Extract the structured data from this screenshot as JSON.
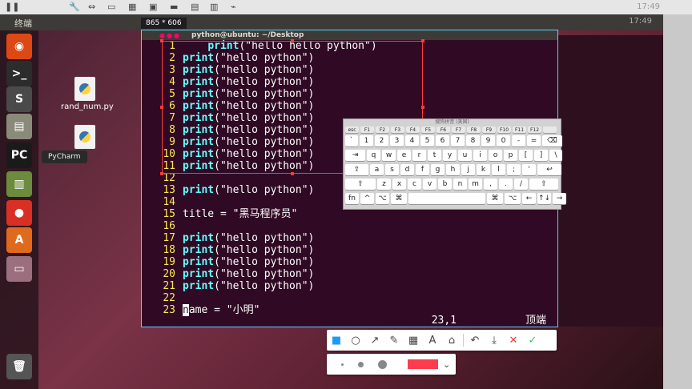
{
  "host": {
    "clock": "17:49"
  },
  "unity": {
    "title": "终端"
  },
  "size_label": "865 * 606",
  "terminal": {
    "title": "python@ubuntu: ~/Desktop",
    "lines": [
      {
        "n": "1",
        "pre": "    ",
        "kw": "print",
        "rest": "(\"hello hello python\")"
      },
      {
        "n": "2",
        "pre": "",
        "kw": "print",
        "rest": "(\"hello python\")"
      },
      {
        "n": "3",
        "pre": "",
        "kw": "print",
        "rest": "(\"hello python\")"
      },
      {
        "n": "4",
        "pre": "",
        "kw": "print",
        "rest": "(\"hello python\")"
      },
      {
        "n": "5",
        "pre": "",
        "kw": "print",
        "rest": "(\"hello python\")"
      },
      {
        "n": "6",
        "pre": "",
        "kw": "print",
        "rest": "(\"hello python\")"
      },
      {
        "n": "7",
        "pre": "",
        "kw": "print",
        "rest": "(\"hello python\")"
      },
      {
        "n": "8",
        "pre": "",
        "kw": "print",
        "rest": "(\"hello python\")"
      },
      {
        "n": "9",
        "pre": "",
        "kw": "print",
        "rest": "(\"hello python\")"
      },
      {
        "n": "10",
        "pre": "",
        "kw": "print",
        "rest": "(\"hello python\")"
      },
      {
        "n": "11",
        "pre": "",
        "kw": "print",
        "rest": "(\"hello python\")"
      },
      {
        "n": "12",
        "pre": "",
        "kw": "",
        "rest": ""
      },
      {
        "n": "13",
        "pre": "",
        "kw": "print",
        "rest": "(\"hello python\")"
      },
      {
        "n": "14",
        "pre": "",
        "kw": "",
        "rest": ""
      },
      {
        "n": "15",
        "pre": "",
        "kw": "",
        "rest": "title = \"黑马程序员\""
      },
      {
        "n": "16",
        "pre": "",
        "kw": "",
        "rest": ""
      },
      {
        "n": "17",
        "pre": "",
        "kw": "print",
        "rest": "(\"hello python\")"
      },
      {
        "n": "18",
        "pre": "",
        "kw": "print",
        "rest": "(\"hello python\")"
      },
      {
        "n": "19",
        "pre": "",
        "kw": "print",
        "rest": "(\"hello python\")"
      },
      {
        "n": "20",
        "pre": "",
        "kw": "print",
        "rest": "(\"hello python\")"
      },
      {
        "n": "21",
        "pre": "",
        "kw": "print",
        "rest": "(\"hello python\")"
      },
      {
        "n": "22",
        "pre": "",
        "kw": "",
        "rest": ""
      },
      {
        "n": "23",
        "pre": "",
        "kw": "",
        "rest": "ame = \"小明\"",
        "cursor": "n"
      }
    ],
    "status_pos": "23,1",
    "status_scroll": "顶端"
  },
  "desktop": {
    "icons": [
      {
        "label": "rand_num.py"
      },
      {
        "label": ""
      }
    ],
    "tooltip": "PyCharm"
  },
  "launcher": [
    {
      "name": "ubuntu-dash-icon",
      "glyph": "◉",
      "color": "#dd4814"
    },
    {
      "name": "terminal-icon",
      "glyph": ">_",
      "color": "#2c2c2c"
    },
    {
      "name": "sublime-icon",
      "glyph": "S",
      "color": "#4a4a4a"
    },
    {
      "name": "files-icon",
      "glyph": "▤",
      "color": "#8a8a7a"
    },
    {
      "name": "pycharm-icon",
      "glyph": "PC",
      "color": "#1a1a1a"
    },
    {
      "name": "books-icon",
      "glyph": "▥",
      "color": "#6c8b3c"
    },
    {
      "name": "chrome-icon",
      "glyph": "●",
      "color": "#d93025"
    },
    {
      "name": "software-center-icon",
      "glyph": "A",
      "color": "#e06a1b"
    },
    {
      "name": "window-icon",
      "glyph": "▭",
      "color": "#9b6f7e"
    },
    {
      "name": "trash-icon",
      "glyph": "🗑",
      "color": "#555"
    }
  ],
  "keyboard": {
    "title": "搜狗拼音 (美国)",
    "frow": [
      "esc",
      "F1",
      "F2",
      "F3",
      "F4",
      "F5",
      "F6",
      "F7",
      "F8",
      "F9",
      "F10",
      "F11",
      "F12",
      ""
    ],
    "rows": [
      [
        "`",
        "1",
        "2",
        "3",
        "4",
        "5",
        "6",
        "7",
        "8",
        "9",
        "0",
        "-",
        "=",
        "⌫"
      ],
      [
        "⇥",
        "q",
        "w",
        "e",
        "r",
        "t",
        "y",
        "u",
        "i",
        "o",
        "p",
        "[",
        "]",
        "\\"
      ],
      [
        "⇪",
        "a",
        "s",
        "d",
        "f",
        "g",
        "h",
        "j",
        "k",
        "l",
        ";",
        "'",
        "↩"
      ],
      [
        "⇧",
        "z",
        "x",
        "c",
        "v",
        "b",
        "n",
        "m",
        ",",
        ".",
        "/",
        "⇧"
      ],
      [
        "fn",
        "^",
        "⌥",
        "⌘",
        " ",
        "⌘",
        "⌥",
        "←",
        "↑↓",
        "→"
      ]
    ]
  },
  "annotation": {
    "tools": [
      {
        "name": "rectangle-tool-icon",
        "glyph": "■",
        "color": "#1a9bfc"
      },
      {
        "name": "ellipse-tool-icon",
        "glyph": "○",
        "color": "#444"
      },
      {
        "name": "arrow-tool-icon",
        "glyph": "↗",
        "color": "#444"
      },
      {
        "name": "pen-tool-icon",
        "glyph": "✎",
        "color": "#444"
      },
      {
        "name": "mosaic-tool-icon",
        "glyph": "▦",
        "color": "#444"
      },
      {
        "name": "text-tool-icon",
        "glyph": "A",
        "color": "#444"
      },
      {
        "name": "tag-tool-icon",
        "glyph": "⌂",
        "color": "#444"
      },
      {
        "sep": true
      },
      {
        "name": "undo-icon",
        "glyph": "↶",
        "color": "#444"
      },
      {
        "name": "download-icon",
        "glyph": "⤓",
        "color": "#444"
      },
      {
        "name": "cancel-icon",
        "glyph": "✕",
        "color": "#e04040"
      },
      {
        "name": "confirm-icon",
        "glyph": "✓",
        "color": "#3cc060"
      }
    ],
    "stroke_color": "#ff3b4f"
  }
}
